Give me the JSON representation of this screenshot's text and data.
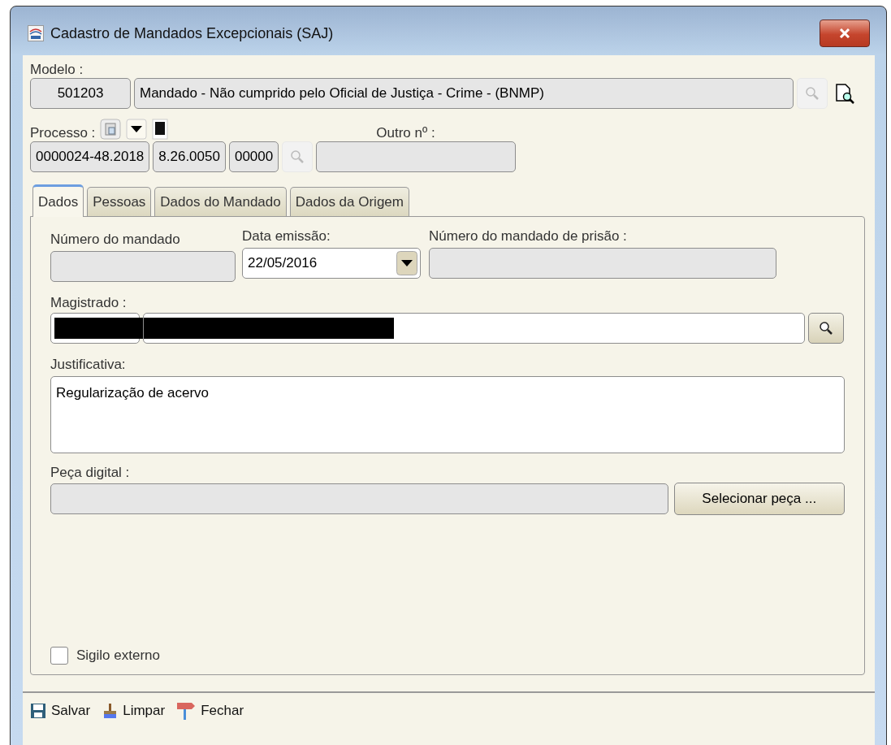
{
  "window": {
    "title": "Cadastro de Mandados Excepcionais (SAJ)"
  },
  "modelo": {
    "label": "Modelo :",
    "code": "501203",
    "description": "Mandado - Não cumprido pelo Oficial de Justiça - Crime - (BNMP)"
  },
  "processo": {
    "label": "Processo :",
    "segments": [
      "0000024-48.2018",
      "8.26.0050",
      "00000"
    ]
  },
  "outro_numero": {
    "label": "Outro nº :"
  },
  "tabs": [
    {
      "label": "Dados",
      "selected": true
    },
    {
      "label": "Pessoas",
      "selected": false
    },
    {
      "label": "Dados do Mandado",
      "selected": false
    },
    {
      "label": "Dados da Origem",
      "selected": false
    }
  ],
  "dados": {
    "numero_mandado": {
      "label": "Número do mandado"
    },
    "data_emissao": {
      "label": "Data emissão:",
      "value": "22/05/2016"
    },
    "numero_mandado_prisao": {
      "label": "Número do mandado de prisão :"
    },
    "magistrado": {
      "label": "Magistrado :",
      "redacted": true
    },
    "justificativa": {
      "label": "Justificativa:",
      "value": "Regularização de acervo"
    },
    "peca_digital": {
      "label": "Peça digital :",
      "button": "Selecionar peça ..."
    },
    "sigilo_externo": {
      "label": "Sigilo externo",
      "checked": false
    }
  },
  "toolbar": [
    {
      "label": "Salvar",
      "kind": "save"
    },
    {
      "label": "Limpar",
      "kind": "clear"
    },
    {
      "label": "Fechar",
      "kind": "close"
    }
  ]
}
